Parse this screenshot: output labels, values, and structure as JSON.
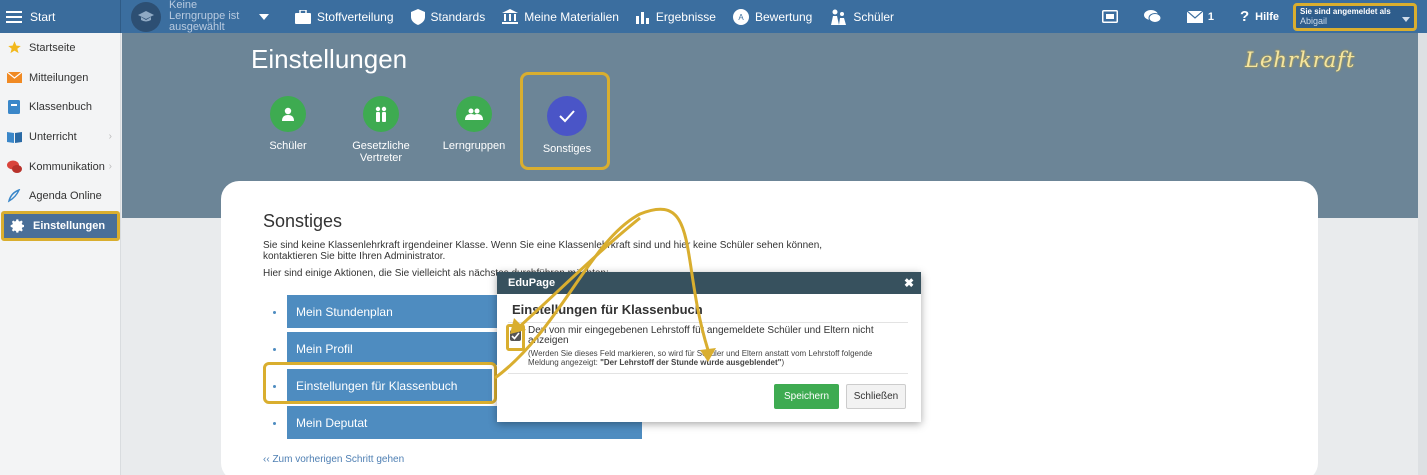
{
  "topbar": {
    "start_label": "Start",
    "group_text": "Keine Lerngruppe ist ausgewählt",
    "nav": [
      {
        "label": "Stoffverteilung",
        "icon": "briefcase-icon"
      },
      {
        "label": "Standards",
        "icon": "shield-icon"
      },
      {
        "label": "Meine Materialien",
        "icon": "bank-icon"
      },
      {
        "label": "Ergebnisse",
        "icon": "bar-chart-icon"
      },
      {
        "label": "Bewertung",
        "icon": "grade-icon"
      },
      {
        "label": "Schüler",
        "icon": "students-icon"
      }
    ],
    "messages_count": "1",
    "help_label": "Hilfe",
    "login_label": "Sie sind angemeldet als",
    "login_user": "Abigail"
  },
  "sidebar": {
    "items": [
      {
        "label": "Startseite",
        "icon": "star-icon"
      },
      {
        "label": "Mitteilungen",
        "icon": "mail-icon"
      },
      {
        "label": "Klassenbuch",
        "icon": "book-icon"
      },
      {
        "label": "Unterricht",
        "icon": "open-book-icon"
      },
      {
        "label": "Kommunikation",
        "icon": "chat-icon"
      },
      {
        "label": "Agenda Online",
        "icon": "pen-icon"
      },
      {
        "label": "Einstellungen",
        "icon": "gear-icon"
      }
    ]
  },
  "header": {
    "title": "Einstellungen",
    "annotation": "Lehrkraft",
    "tabs": [
      {
        "label": "Schüler",
        "icon": "person-icon"
      },
      {
        "label": "Gesetzliche Vertreter",
        "icon": "parents-icon"
      },
      {
        "label": "Lerngruppen",
        "icon": "group-icon"
      },
      {
        "label": "Sonstiges",
        "icon": "check-icon"
      }
    ]
  },
  "card": {
    "title": "Sonstiges",
    "paragraph1": "Sie sind keine Klassenlehrkraft irgendeiner Klasse. Wenn Sie eine Klassenlehrkraft sind und hier keine Schüler sehen können, kontaktieren Sie bitte Ihren Administrator.",
    "paragraph2": "Hier sind einige Aktionen, die Sie vielleicht als nächstes durchführen möchten:",
    "actions": [
      "Mein Stundenplan",
      "Mein Profil",
      "Einstellungen für Klassenbuch",
      "Mein Deputat"
    ],
    "back_link": "‹‹ Zum vorherigen Schritt gehen"
  },
  "dialog": {
    "header": "EduPage",
    "close_glyph": "✖",
    "title": "Einstellungen für Klassenbuch",
    "checkbox_checked": true,
    "checkbox_label": "Den von mir eingegebenen Lehrstoff für angemeldete Schüler und Eltern nicht anzeigen",
    "note_prefix": "(Werden Sie dieses Feld markieren, so wird für Schüler und Eltern anstatt vom Lehrstoff folgende Meldung angezeigt: ",
    "note_bold": "\"Der Lehrstoff der Stunde wurde ausgeblendet\"",
    "note_suffix": ")",
    "save_label": "Speichern",
    "close_label": "Schließen"
  },
  "colors": {
    "topbar": "#3b6e9f",
    "header": "#6c8597",
    "highlight": "#d9ae2f",
    "action": "#4e8cc0",
    "green": "#3eab51",
    "selected_tab": "#4a55c7"
  }
}
